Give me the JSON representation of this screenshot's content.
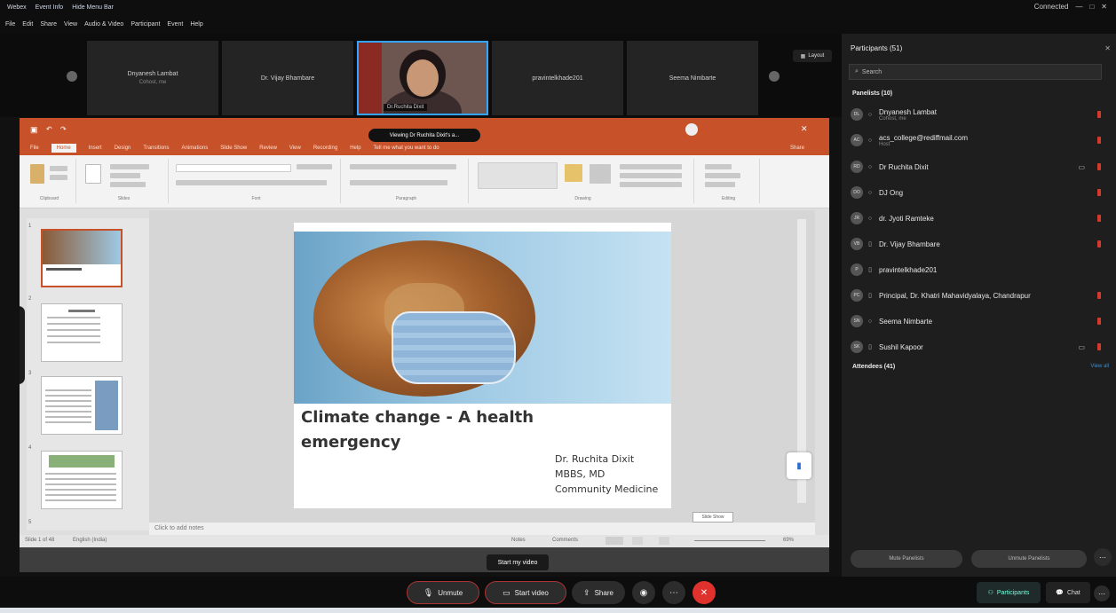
{
  "titlebar": {
    "app": "Webex",
    "event_info": "Event Info",
    "hide_menu": "Hide Menu Bar",
    "status": "Connected",
    "controls": [
      "—",
      "□",
      "✕"
    ]
  },
  "menubar": [
    "File",
    "Edit",
    "Share",
    "View",
    "Audio & Video",
    "Participant",
    "Event",
    "Help"
  ],
  "video_strip": {
    "tiles": [
      {
        "name": "Dnyanesh Lambat",
        "sub": "Cohost, me"
      },
      {
        "name": "Dr. Vijay Bhambare",
        "sub": ""
      },
      {
        "name": "Dr.Ruchita Dixit",
        "sub": ""
      },
      {
        "name": "pravintelkhade201",
        "sub": ""
      },
      {
        "name": "Seema Nimbarte",
        "sub": ""
      }
    ],
    "layout_label": "Layout"
  },
  "share": {
    "viewing_label": "Viewing Dr Ruchita Dixit's a...",
    "ppt_tabs": [
      "File",
      "Home",
      "Insert",
      "Design",
      "Transitions",
      "Animations",
      "Slide Show",
      "Review",
      "View",
      "Recording",
      "Help",
      "Tell me what you want to do"
    ],
    "active_tab": "Home",
    "share_label": "Share",
    "ribbon_groups": [
      "Clipboard",
      "Slides",
      "Font",
      "Paragraph",
      "Drawing",
      "Editing"
    ],
    "slide_numbers": [
      "1",
      "2",
      "3",
      "4",
      "5"
    ],
    "slide_title": "Climate change - A health emergency",
    "slide_author": [
      "Dr. Ruchita Dixit",
      "MBBS, MD",
      "Community Medicine"
    ],
    "notes_placeholder": "Click to add notes",
    "status_left": "Slide 1 of 48",
    "status_lang": "English (India)",
    "notes_btn": "Notes",
    "comments_btn": "Comments",
    "zoom": "69%",
    "slideshow_tip": "Slide Show",
    "tooltip": "Start my video"
  },
  "panel": {
    "title": "Participants (51)",
    "search_placeholder": "Search",
    "panelists_header": "Panelists (10)",
    "attendees_header": "Attendees (41)",
    "attendees_link": "View all",
    "participants": [
      {
        "initials": "DL",
        "name": "Dnyanesh Lambat",
        "sub": "Cohost, me",
        "mic": "○",
        "cam": ""
      },
      {
        "initials": "AC",
        "name": "acs_college@rediffmail.com",
        "sub": "Host",
        "mic": "○",
        "cam": ""
      },
      {
        "initials": "RD",
        "name": "Dr Ruchita Dixit",
        "sub": "",
        "mic": "○",
        "cam": "▭"
      },
      {
        "initials": "DO",
        "name": "DJ Ong",
        "sub": "",
        "mic": "○",
        "cam": ""
      },
      {
        "initials": "JR",
        "name": "dr. Jyoti Ramteke",
        "sub": "",
        "mic": "○",
        "cam": ""
      },
      {
        "initials": "VB",
        "name": "Dr. Vijay Bhambare",
        "sub": "",
        "mic": "▯",
        "cam": ""
      },
      {
        "initials": "P",
        "name": "pravintelkhade201",
        "sub": "",
        "mic": "▯",
        "cam": ""
      },
      {
        "initials": "PC",
        "name": "Principal, Dr. Khatri Mahavidyalaya, Chandrapur",
        "sub": "",
        "mic": "▯",
        "cam": ""
      },
      {
        "initials": "SN",
        "name": "Seema Nimbarte",
        "sub": "",
        "mic": "○",
        "cam": ""
      },
      {
        "initials": "SK",
        "name": "Sushil Kapoor",
        "sub": "",
        "mic": "▯",
        "cam": "▭"
      }
    ],
    "mute_btn": "Mute Panelists",
    "unmute_btn": "Unmute Panelists"
  },
  "controls": {
    "unmute": "Unmute",
    "start_video": "Start video",
    "share": "Share",
    "participants": "Participants",
    "chat": "Chat"
  },
  "colors": {
    "ppt_accent": "#c7522a",
    "leave_red": "#e0322c",
    "active_border": "#33a4ff"
  }
}
